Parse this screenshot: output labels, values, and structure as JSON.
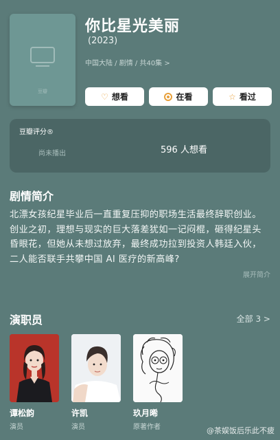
{
  "show": {
    "title": "你比星光美丽",
    "year": "(2023)",
    "meta": "中国大陆 / 剧情 / 共40集 >"
  },
  "actions": [
    {
      "icon": "heart-plus-icon",
      "label": "想看"
    },
    {
      "icon": "watching-icon",
      "label": "在看"
    },
    {
      "icon": "star-icon",
      "label": "看过"
    }
  ],
  "rating": {
    "label": "豆瓣评分®",
    "status": "尚未播出",
    "want_count": "596 人想看"
  },
  "synopsis": {
    "heading": "剧情简介",
    "text": "北漂女孩纪星毕业后一直重复压抑的职场生活最终辞职创业。创业之初，理想与现实的巨大落差犹如一记闷棍，砸得纪星头昏眼花，但她从未想过放弃，最终成功拉到投资人韩廷入伙，二人能否联手共攀中国 AI 医疗的新高峰?",
    "source": "展开简介"
  },
  "cast": {
    "heading": "演职员",
    "all_label": "全部 3 >",
    "members": [
      {
        "name": "谭松韵",
        "role": "演员"
      },
      {
        "name": "许凯",
        "role": "演员"
      },
      {
        "name": "玖月晞",
        "role": "原著作者"
      }
    ]
  },
  "watermark": "@茶娱饭后乐此不疲",
  "colors": {
    "background": "#5b7b79",
    "card": "#4b6665",
    "accent": "#e8a03a"
  }
}
